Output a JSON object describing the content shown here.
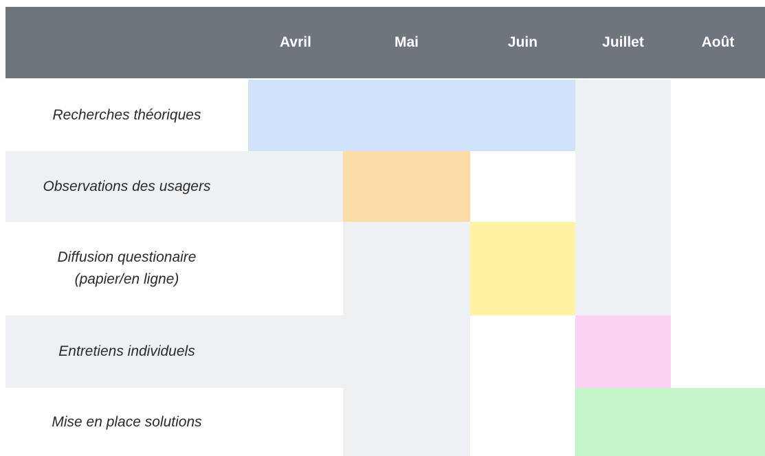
{
  "chart_data": {
    "type": "gantt",
    "title": "",
    "months": [
      "Avril",
      "Mai",
      "Juin",
      "Juillet",
      "Août"
    ],
    "tasks": [
      {
        "label": "Recherches théoriques",
        "start": "Avril",
        "end": "Juin",
        "color": "#d1e3fa"
      },
      {
        "label": "Observations des usagers",
        "start": "Mai",
        "end": "Mai",
        "color": "#fcdca8"
      },
      {
        "label": "Diffusion questionaire\n(papier/en ligne)",
        "start": "Juin",
        "end": "Juin",
        "color": "#fdf3a3"
      },
      {
        "label": "Entretiens individuels",
        "start": "Juillet",
        "end": "Juillet",
        "color": "#fad2f2"
      },
      {
        "label": "Mise en place solutions",
        "start": "Juillet",
        "end": "Août",
        "color": "#c4f5c8"
      }
    ]
  },
  "colors": {
    "header": "#6e757c",
    "header_text": "#ffffff",
    "band": "#eef1f4",
    "label_text": "#2a2a2a"
  }
}
